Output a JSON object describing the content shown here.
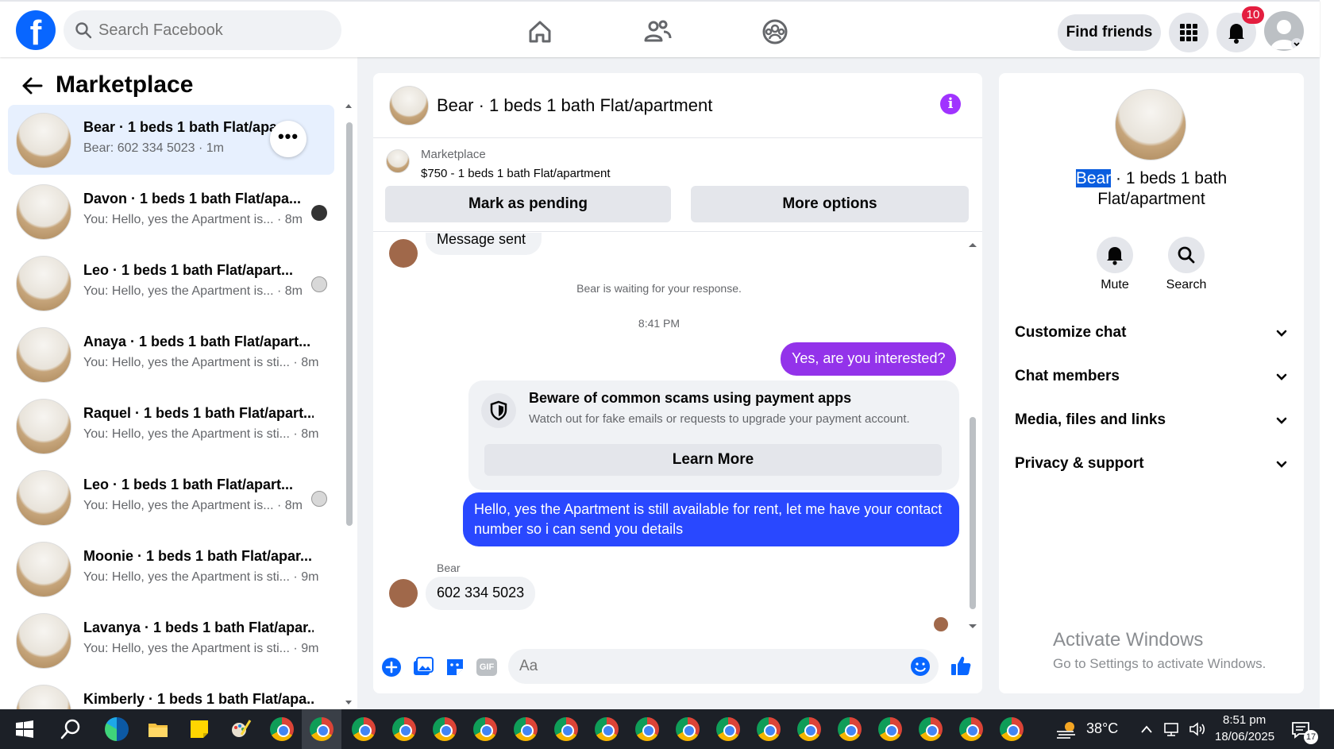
{
  "topbar": {
    "search_placeholder": "Search Facebook",
    "find_friends": "Find friends",
    "notification_count": "10"
  },
  "left": {
    "title": "Marketplace",
    "conversations": [
      {
        "name": "Bear · 1 beds 1 bath Flat/apar...",
        "snippet": "Bear: 602 334 5023 · 1m"
      },
      {
        "name": "Davon · 1 beds 1 bath Flat/apa...",
        "snippet": "You: Hello, yes the Apartment is... · 8m"
      },
      {
        "name": "Leo · 1 beds 1 bath Flat/apart...",
        "snippet": "You: Hello, yes the Apartment is... · 8m"
      },
      {
        "name": "Anaya · 1 beds 1 bath Flat/apart...",
        "snippet": "You: Hello, yes the Apartment is sti... · 8m"
      },
      {
        "name": "Raquel · 1 beds 1 bath Flat/apart...",
        "snippet": "You: Hello, yes the Apartment is sti... · 8m"
      },
      {
        "name": "Leo · 1 beds 1 bath Flat/apart...",
        "snippet": "You: Hello, yes the Apartment is... · 8m"
      },
      {
        "name": "Moonie · 1 beds 1 bath Flat/apar...",
        "snippet": "You: Hello, yes the Apartment is sti... · 9m"
      },
      {
        "name": "Lavanya · 1 beds 1 bath Flat/apar...",
        "snippet": "You: Hello, yes the Apartment is sti... · 9m"
      },
      {
        "name": "Kimberly · 1 beds 1 bath Flat/apa...",
        "snippet": ""
      }
    ]
  },
  "chat": {
    "title": "Bear · 1 beds 1 bath Flat/apartment",
    "marketplace_label": "Marketplace",
    "listing": "$750 - 1 beds 1 bath Flat/apartment",
    "mark_pending": "Mark as pending",
    "more_options": "More options",
    "partial_msg": "Message sent",
    "waiting": "Bear is waiting for your response.",
    "time": "8:41 PM",
    "msg_interested": "Yes, are you interested?",
    "scam_title": "Beware of common scams using payment apps",
    "scam_body": "Watch out for fake emails or requests to upgrade your payment account.",
    "learn_more": "Learn More",
    "msg_available": "Hello, yes the Apartment is still available for rent, let me have your contact number so i can send you details",
    "sender": "Bear",
    "msg_phone": "602 334 5023",
    "composer_placeholder": "Aa",
    "gif": "GIF"
  },
  "right": {
    "name_highlight": "Bear",
    "name_rest": " · 1 beds 1 bath",
    "name_line2": "Flat/apartment",
    "mute": "Mute",
    "search": "Search",
    "sections": [
      "Customize chat",
      "Chat members",
      "Media, files and links",
      "Privacy & support"
    ],
    "watermark_title": "Activate Windows",
    "watermark_sub": "Go to Settings to activate Windows."
  },
  "taskbar": {
    "temperature": "38°C",
    "time": "8:51 pm",
    "date": "18/06/2025",
    "notif_count": "17"
  },
  "colors": {
    "brand": "#0866ff",
    "purple": "#a033ff",
    "blue_msg": "#2948ff"
  }
}
